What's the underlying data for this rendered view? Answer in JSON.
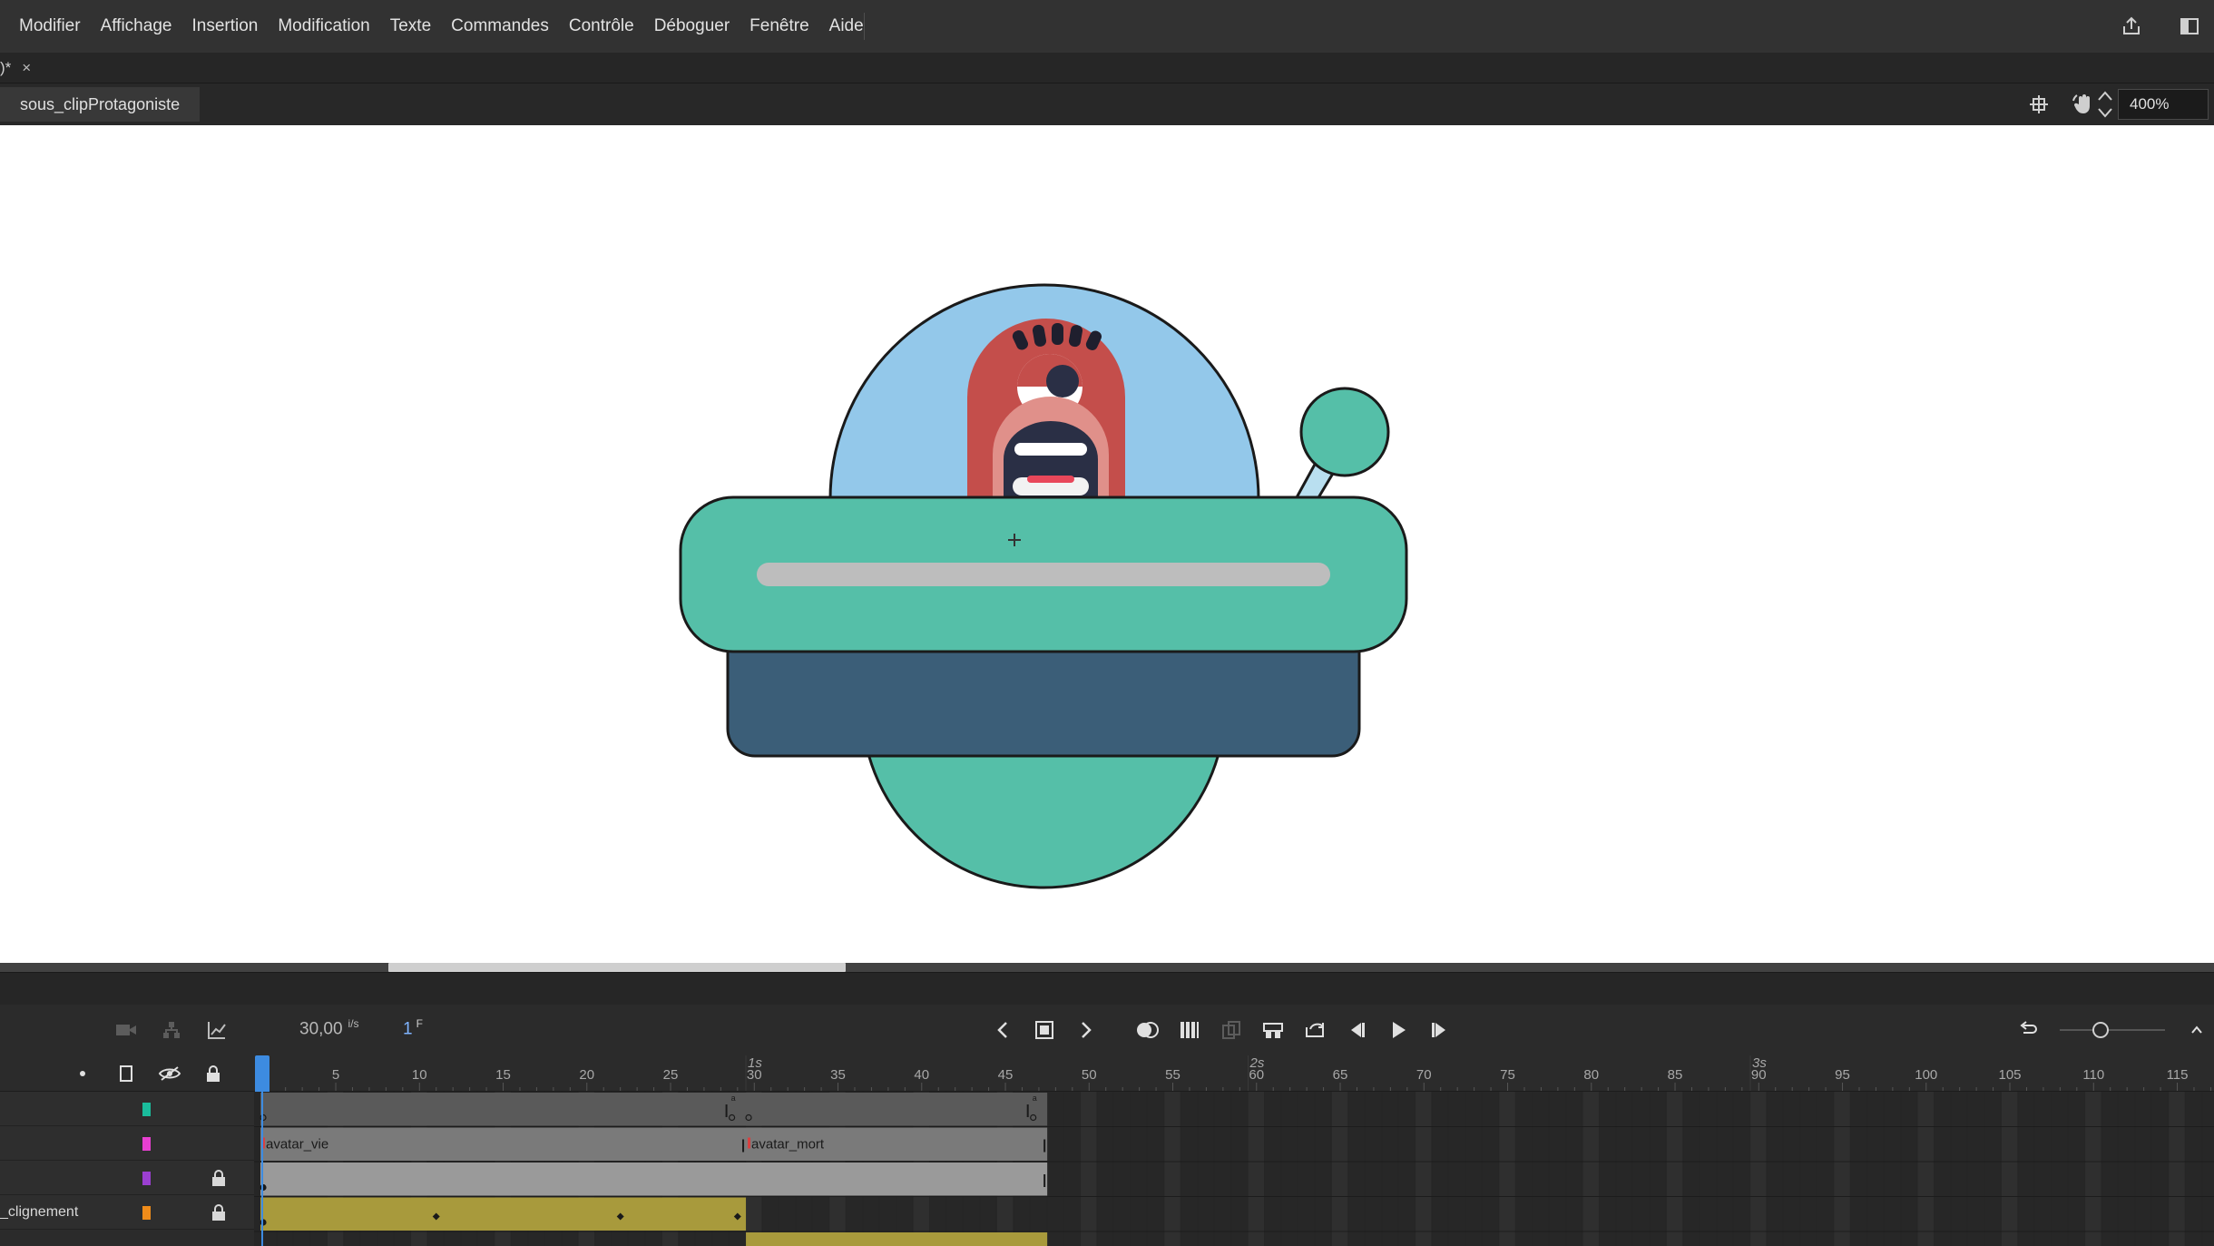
{
  "menubar": {
    "items": [
      "Modifier",
      "Affichage",
      "Insertion",
      "Modification",
      "Texte",
      "Commandes",
      "Contrôle",
      "Déboguer",
      "Fenêtre",
      "Aide"
    ],
    "right_icons": [
      "share-icon",
      "panel-toggle-icon"
    ]
  },
  "doc_tab": {
    "label": ")*",
    "close": "×"
  },
  "editbar": {
    "scene": "sous_clipProtagoniste",
    "zoom": "400%",
    "tool_icons": [
      "snap-icon",
      "hand-rotate-icon",
      "clip-icon"
    ]
  },
  "timeline": {
    "fps": "30,00",
    "fps_unit": "i/s",
    "frame": "1",
    "frame_unit": "F",
    "time_markers": [
      "1s",
      "2s",
      "3s"
    ],
    "ruler_ticks": [
      "5",
      "10",
      "15",
      "20",
      "25",
      "30",
      "35",
      "40",
      "45",
      "50",
      "55",
      "60",
      "65",
      "70",
      "75",
      "80",
      "85",
      "90",
      "95",
      "100",
      "105",
      "110",
      "115"
    ],
    "layers": [
      {
        "name": "",
        "color": "#1abc9c",
        "locked": false
      },
      {
        "name": "",
        "color": "#e83fd1",
        "locked": false
      },
      {
        "name": "",
        "color": "#9b3fd1",
        "locked": true
      },
      {
        "name": "_clignement",
        "color": "#f08c1a",
        "locked": true
      }
    ],
    "frame_labels": [
      "avatar_vie",
      "avatar_mort"
    ]
  },
  "colors": {
    "accent": "#3d8be0",
    "ship_body": "#55bfa8",
    "ship_base": "#3b5e78",
    "dome": "#93c8ea",
    "alien": "#c44e4b",
    "tween": "#a89a3c"
  }
}
